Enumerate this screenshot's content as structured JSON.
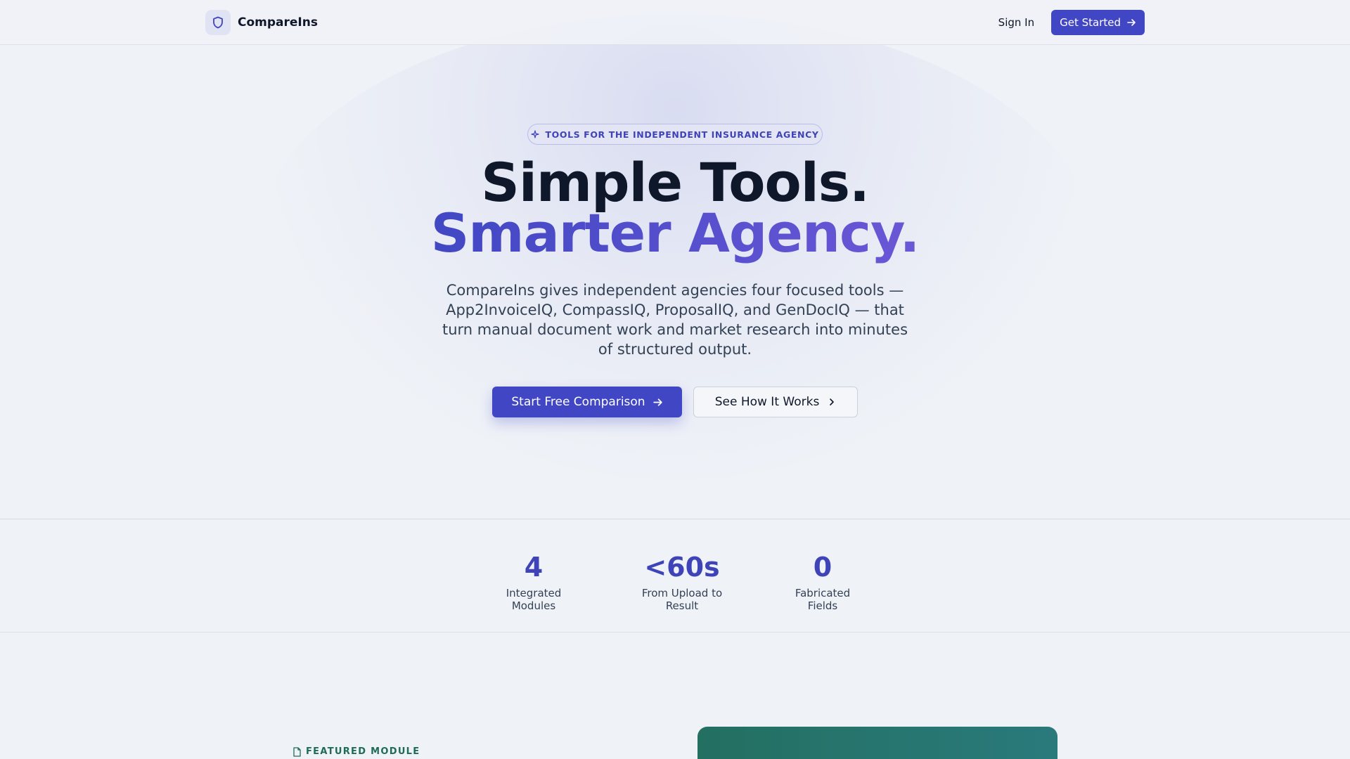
{
  "header": {
    "brand": "CompareIns",
    "sign_in": "Sign In",
    "get_started": "Get Started"
  },
  "hero": {
    "badge": "TOOLS FOR THE INDEPENDENT INSURANCE AGENCY",
    "title_line1": "Simple Tools.",
    "title_line2": "Smarter Agency.",
    "lead": "CompareIns gives independent agencies four focused tools — App2InvoiceIQ, CompassIQ, ProposalIQ, and GenDocIQ — that turn manual document work and market research into minutes of structured output.",
    "primary_cta": "Start Free Comparison",
    "secondary_cta": "See How It Works"
  },
  "stats": [
    {
      "value": "4",
      "label": "Integrated Modules"
    },
    {
      "value": "<60s",
      "label": "From Upload to Result"
    },
    {
      "value": "0",
      "label": "Fabricated Fields"
    }
  ],
  "featured": {
    "label": "FEATURED MODULE"
  },
  "colors": {
    "accent": "#4147c4",
    "accent_gradient_end": "#6a57d6",
    "featured_green": "#1f6b5a",
    "background": "#eff2f7"
  },
  "icons": {
    "brand": "shield-icon",
    "badge": "sparkle-icon",
    "cta_arrow": "arrow-right-icon",
    "secondary_chevron": "chevron-right-icon",
    "featured": "document-icon"
  }
}
